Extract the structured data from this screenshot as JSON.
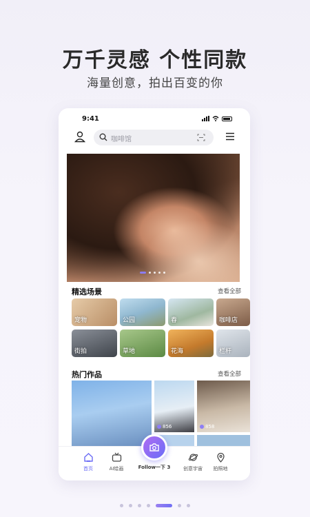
{
  "headline": "万千灵感 个性同款",
  "subline": "海量创意，拍出百变的你",
  "status": {
    "time": "9:41"
  },
  "search": {
    "placeholder": "咖啡馆"
  },
  "scenes": {
    "title": "精选场景",
    "more": "查看全部",
    "items": [
      {
        "label": "宠物",
        "color": "#c9a27a"
      },
      {
        "label": "公园",
        "color": "#8fb7cf"
      },
      {
        "label": "春",
        "color": "#9fb8a0"
      },
      {
        "label": "咖啡店",
        "color": "#a27a5e"
      },
      {
        "label": "街拍",
        "color": "#4e5560"
      },
      {
        "label": "草地",
        "color": "#6f9a52"
      },
      {
        "label": "花海",
        "color": "#d48c3b"
      },
      {
        "label": "栏杆",
        "color": "#aab3bd"
      }
    ]
  },
  "works": {
    "title": "热门作品",
    "more": "查看全部",
    "likes": [
      "856",
      "858"
    ]
  },
  "tabs": [
    {
      "label": "首页",
      "icon": "home-icon",
      "active": true
    },
    {
      "label": "AI绘画",
      "icon": "tv-icon"
    },
    {
      "label": "Follow一下 3",
      "icon": "camera-icon"
    },
    {
      "label": "创意宇宙",
      "icon": "planet-icon"
    },
    {
      "label": "拍照地",
      "icon": "location-pin-icon"
    }
  ],
  "colors": {
    "accent": "#6b6cf5",
    "accent2": "#b06cf2"
  }
}
